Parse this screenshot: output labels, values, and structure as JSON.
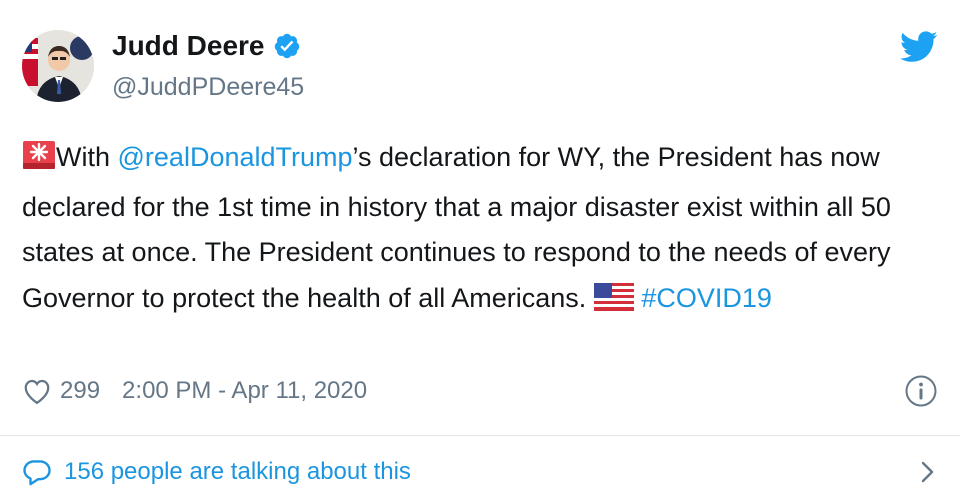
{
  "author": {
    "name": "Judd Deere",
    "handle": "@JuddPDeere45",
    "verified": true
  },
  "tweet": {
    "text_prefix": "With ",
    "mention": "@realDonaldTrump",
    "text_body": "’s declaration for WY, the President has now declared for the 1st time in history that a major disaster exist within all 50 states at once. The President continues to respond to the needs of every Governor to protect the health of all Americans. ",
    "hashtag": "#COVID19",
    "emojis": [
      "rotating-light-icon",
      "us-flag-icon"
    ]
  },
  "meta": {
    "likes": "299",
    "timestamp": "2:00 PM - Apr 11, 2020"
  },
  "footer": {
    "talking_text": "156 people are talking about this"
  },
  "colors": {
    "text": "#14171a",
    "secondary": "#657786",
    "link": "#1b95e0",
    "verified": "#1da1f2",
    "divider": "#e1e8ed"
  }
}
